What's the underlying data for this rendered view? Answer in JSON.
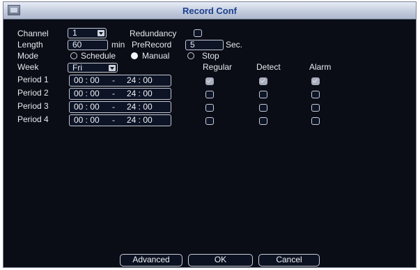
{
  "window": {
    "title": "Record Conf"
  },
  "channel": {
    "label": "Channel",
    "value": "1"
  },
  "redundancy": {
    "label": "Redundancy"
  },
  "length": {
    "label": "Length",
    "value": "60",
    "unit": "min"
  },
  "prerecord": {
    "label": "PreRecord",
    "value": "5",
    "unit": "Sec."
  },
  "mode": {
    "label": "Mode",
    "options": [
      "Schedule",
      "Manual",
      "Stop"
    ],
    "selected": "Manual"
  },
  "week": {
    "label": "Week",
    "value": "Fri"
  },
  "columns": [
    "Regular",
    "Detect",
    "Alarm"
  ],
  "periods": [
    {
      "label": "Period 1",
      "start": "00 : 00",
      "sep": "-",
      "end": "24 : 00",
      "regular": true,
      "detect": true,
      "alarm": true
    },
    {
      "label": "Period 2",
      "start": "00 : 00",
      "sep": "-",
      "end": "24 : 00",
      "regular": false,
      "detect": false,
      "alarm": false
    },
    {
      "label": "Period 3",
      "start": "00 : 00",
      "sep": "-",
      "end": "24 : 00",
      "regular": false,
      "detect": false,
      "alarm": false
    },
    {
      "label": "Period 4",
      "start": "00 : 00",
      "sep": "-",
      "end": "24 : 00",
      "regular": false,
      "detect": false,
      "alarm": false
    }
  ],
  "buttons": {
    "advanced": "Advanced",
    "ok": "OK",
    "cancel": "Cancel"
  }
}
